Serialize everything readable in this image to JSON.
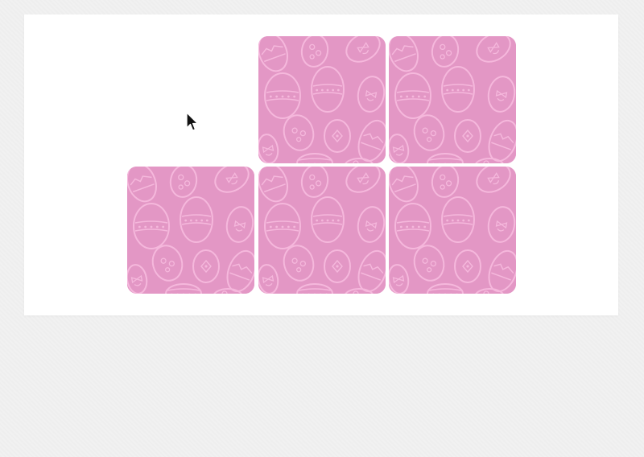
{
  "game": {
    "card_back_color": "#e397c5",
    "card_pattern_color": "#f5b8dc",
    "card_back_icon": "easter-egg-pattern-icon",
    "cards_remaining": 5,
    "cards": [
      {
        "id": "card-1",
        "face": "down"
      },
      {
        "id": "card-2",
        "face": "down"
      },
      {
        "id": "card-3",
        "face": "down"
      },
      {
        "id": "card-4",
        "face": "down"
      },
      {
        "id": "card-5",
        "face": "down"
      }
    ]
  },
  "cursor": {
    "icon": "mouse-pointer-icon"
  }
}
